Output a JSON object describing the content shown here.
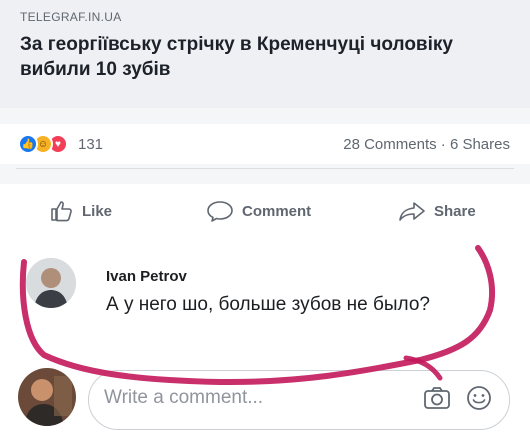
{
  "post": {
    "source": "TELEGRAF.IN.UA",
    "headline": "За георгіївську стрічку в Кременчуці чоловіку вибили 10 зубів"
  },
  "stats": {
    "reaction_count": "131",
    "comments_shares": "28 Comments · 6 Shares",
    "reactions": [
      "like-icon",
      "haha-icon",
      "love-icon"
    ]
  },
  "actions": {
    "like": "Like",
    "comment": "Comment",
    "share": "Share"
  },
  "comment": {
    "author": "Ivan Petrov",
    "text": "А у него шо, больше зубов не было?"
  },
  "composer": {
    "placeholder": "Write a comment..."
  },
  "colors": {
    "facebook_blue": "#1877f2",
    "annotation_magenta": "#c2185b",
    "text_secondary": "#606770"
  }
}
